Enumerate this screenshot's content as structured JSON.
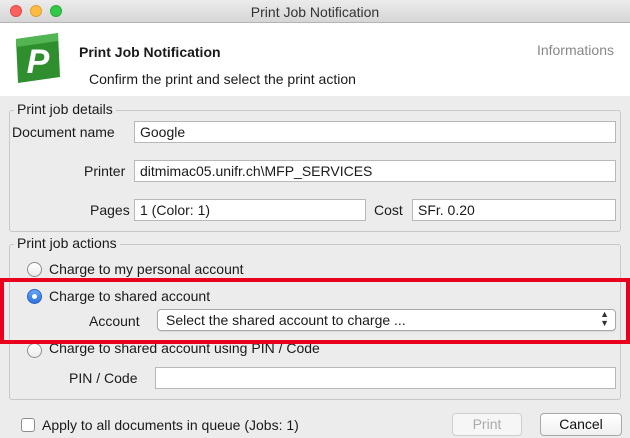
{
  "window": {
    "title": "Print Job Notification"
  },
  "header": {
    "title": "Print Job Notification",
    "subtitle": "Confirm the print and select the print action",
    "info_link": "Informations",
    "logo_letter": "P",
    "logo_color": "#3a9a3a"
  },
  "details": {
    "legend": "Print job details",
    "document_name_label": "Document name",
    "document_name_value": "Google",
    "printer_label": "Printer",
    "printer_value": "ditmimac05.unifr.ch\\MFP_SERVICES",
    "pages_label": "Pages",
    "pages_value": "1  (Color: 1)",
    "cost_label": "Cost",
    "cost_value": "SFr. 0.20"
  },
  "actions": {
    "legend": "Print job actions",
    "personal_label": "Charge to my personal account",
    "shared_label": "Charge to shared account",
    "account_label": "Account",
    "account_select_value": "Select the shared account to charge ...",
    "pin_option_label": "Charge to shared account using PIN / Code",
    "pin_label": "PIN / Code",
    "pin_value": ""
  },
  "footer": {
    "apply_all_label": "Apply to all documents in queue (Jobs: 1)",
    "print_button": "Print",
    "cancel_button": "Cancel"
  },
  "colors": {
    "highlight": "#e8001c",
    "selected_radio": "#2b73e0"
  }
}
